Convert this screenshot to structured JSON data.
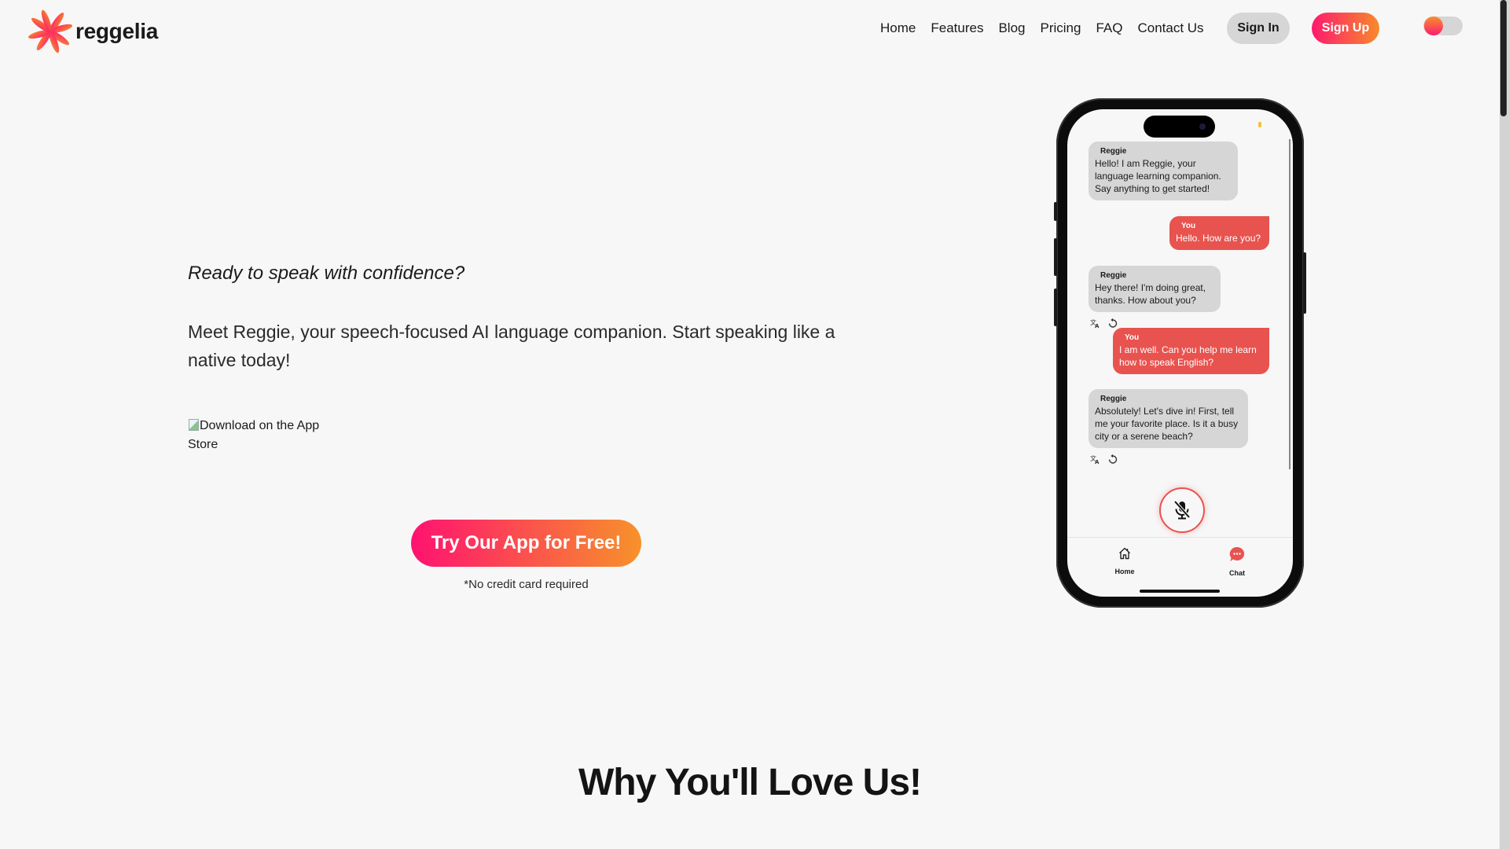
{
  "brand": {
    "name": "reggelia",
    "logo_icon": "flower-logo-icon"
  },
  "nav": {
    "links": [
      {
        "label": "Home"
      },
      {
        "label": "Features"
      },
      {
        "label": "Blog"
      },
      {
        "label": "Pricing"
      },
      {
        "label": "FAQ"
      },
      {
        "label": "Contact Us"
      }
    ],
    "sign_in_label": "Sign In",
    "sign_up_label": "Sign Up",
    "theme_toggle": "theme-toggle"
  },
  "hero": {
    "tagline": "Ready to speak with confidence?",
    "intro": "Meet Reggie, your speech-focused AI language companion. Start speaking like a native today!",
    "app_store_alt": "Download on the App Store",
    "cta_label": "Try Our App for Free!",
    "cta_note": "*No credit card required"
  },
  "phone": {
    "messages": [
      {
        "sender": "Reggie",
        "role": "bot",
        "text": "Hello! I am Reggie, your language learning companion. Say anything to get started!"
      },
      {
        "sender": "You",
        "role": "user",
        "text": "Hello. How are you?"
      },
      {
        "sender": "Reggie",
        "role": "bot",
        "text": "Hey there! I'm doing great, thanks. How about you?"
      },
      {
        "sender": "You",
        "role": "user",
        "text": "I am well. Can you help me learn how to speak English?"
      },
      {
        "sender": "Reggie",
        "role": "bot",
        "text": "Absolutely! Let's dive in! First, tell me your favorite place. Is it a busy city or a serene beach?"
      }
    ],
    "tabs": [
      {
        "label": "Home",
        "icon": "home-icon"
      },
      {
        "label": "Chat",
        "icon": "chat-icon",
        "active": true
      }
    ],
    "mic_state": "muted"
  },
  "sections": {
    "why_title": "Why You'll Love Us!"
  },
  "colors": {
    "accent_pink": "#ff1a6e",
    "accent_orange": "#f78a2b",
    "user_bubble": "#e8534f",
    "bot_bubble": "#d6d6d6",
    "background": "#f7f7f7"
  }
}
